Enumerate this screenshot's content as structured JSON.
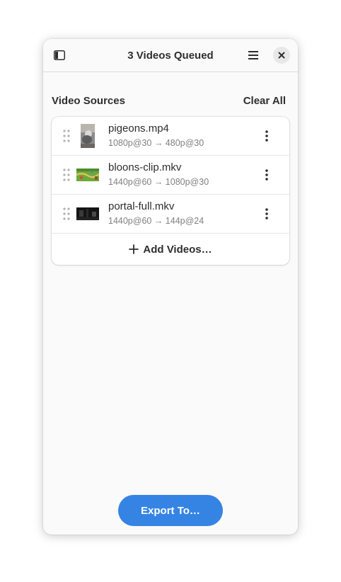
{
  "window": {
    "title": "3 Videos Queued"
  },
  "headerbar": {
    "left_icon": "sidebar-toggle-icon",
    "menu_icon": "hamburger-menu-icon",
    "close_icon": "close-icon"
  },
  "sources": {
    "title": "Video Sources",
    "clear_label": "Clear All",
    "items": [
      {
        "name": "pigeons.mp4",
        "detail": "1080p@30 → 480p@30",
        "thumb": "portrait-thumbnail"
      },
      {
        "name": "bloons-clip.mkv",
        "detail": "1440p@60 → 1080p@30",
        "thumb": "game-thumbnail"
      },
      {
        "name": "portal-full.mkv",
        "detail": "1440p@60 → 144p@24",
        "thumb": "dark-thumbnail"
      }
    ],
    "add_label": "Add Videos…"
  },
  "export_label": "Export To…",
  "colors": {
    "accent": "#3584e4",
    "window_bg": "#fafafa",
    "list_bg": "#ffffff"
  }
}
